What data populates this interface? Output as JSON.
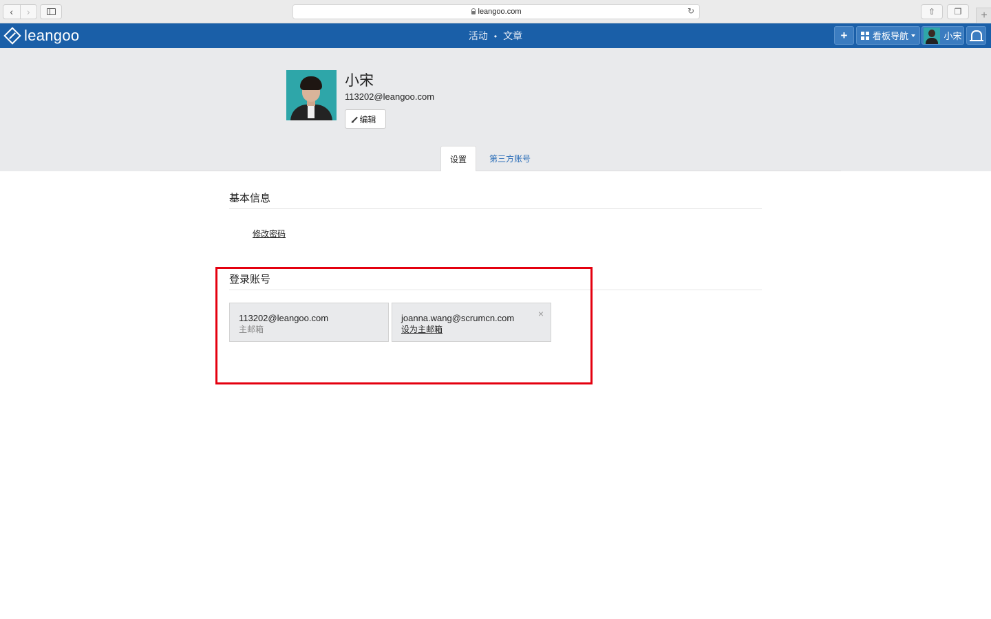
{
  "browser": {
    "url": "leangoo.com",
    "icons": [
      "back-icon",
      "forward-icon",
      "sidebar-icon",
      "lock-icon",
      "reload-icon",
      "share-icon",
      "tabs-icon",
      "new-tab-icon"
    ]
  },
  "header": {
    "brand": "leangoo",
    "nav": [
      "活动",
      "文章"
    ],
    "nav_separator": "•",
    "add_label": "+",
    "board_nav_label": "看板导航",
    "user_name": "小宋",
    "accent_color": "#1a5fa8"
  },
  "profile": {
    "name": "小宋",
    "email": "113202@leangoo.com",
    "edit_label": "编辑"
  },
  "tabs": {
    "settings": "设置",
    "third_party": "第三方账号"
  },
  "basic_info": {
    "title": "基本信息",
    "change_password": "修改密码"
  },
  "login_accounts": {
    "title": "登录账号",
    "accounts": [
      {
        "email": "113202@leangoo.com",
        "sub": "主邮箱"
      },
      {
        "email": "joanna.wang@scrumcn.com",
        "action": "设为主邮箱",
        "remove": "×"
      }
    ],
    "highlight_color": "#e4000f"
  }
}
